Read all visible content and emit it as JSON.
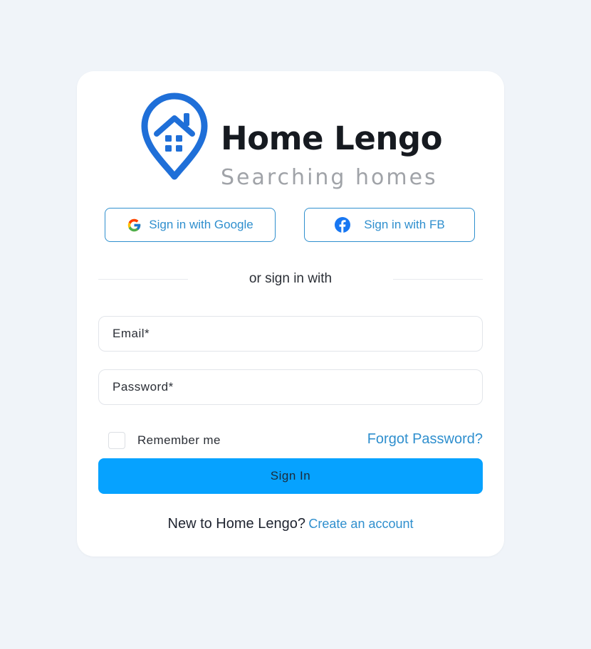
{
  "brand": {
    "name": "Home Lengo",
    "tagline": "Searching homes"
  },
  "social": {
    "google_label": "Sign in with Google",
    "facebook_label": "Sign in with FB"
  },
  "divider_text": "or sign in with",
  "form": {
    "email_placeholder": "Email*",
    "email_value": "",
    "password_placeholder": "Password*",
    "password_value": "",
    "remember_label": "Remember me",
    "remember_checked": false,
    "forgot_label": "Forgot Password?",
    "submit_label": "Sign In"
  },
  "signup": {
    "prompt": "New to Home Lengo?",
    "link_label": "Create an account"
  },
  "icons": {
    "logo": "house-location-pin-icon",
    "google": "google-icon",
    "facebook": "facebook-icon"
  },
  "colors": {
    "page_background": "#f0f4f9",
    "card_background": "#ffffff",
    "brand_blue": "#1f6fd8",
    "link_blue": "#2f8fce",
    "primary_button": "#06a2ff",
    "facebook_blue": "#1877f2"
  }
}
